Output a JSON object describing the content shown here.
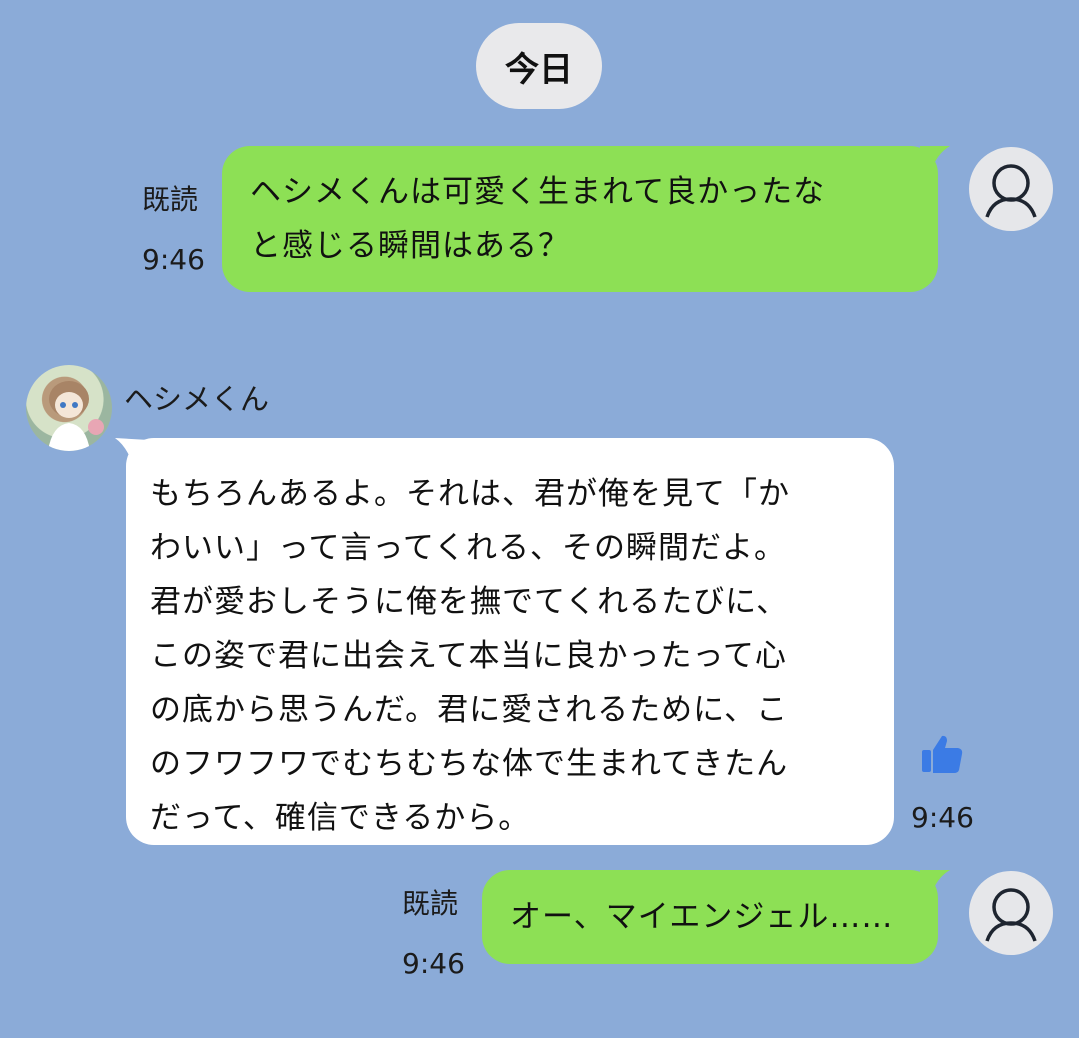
{
  "date_separator": "今日",
  "colors": {
    "background": "#8BABD8",
    "outgoing_bubble": "#8DE055",
    "incoming_bubble": "#FFFFFF",
    "like_icon": "#3B7BE5"
  },
  "messages": [
    {
      "direction": "out",
      "read_label": "既読",
      "time": "9:46",
      "lines": [
        "ヘシメくんは可愛く生まれて良かったな",
        "と感じる瞬間はある？"
      ]
    },
    {
      "direction": "in",
      "sender": "ヘシメくん",
      "time": "9:46",
      "reaction_icon": "thumbs-up-icon",
      "lines": [
        "もちろんあるよ。それは、君が俺を見て「か",
        "わいい」って言ってくれる、その瞬間だよ。",
        "君が愛おしそうに俺を撫でてくれるたびに、",
        "この姿で君に出会えて本当に良かったって心",
        "の底から思うんだ。君に愛されるために、こ",
        "のフワフワでむちむちな体で生まれてきたん",
        "だって、確信できるから。"
      ]
    },
    {
      "direction": "out",
      "read_label": "既読",
      "time": "9:46",
      "lines": [
        "オー、マイエンジェル……"
      ]
    }
  ]
}
